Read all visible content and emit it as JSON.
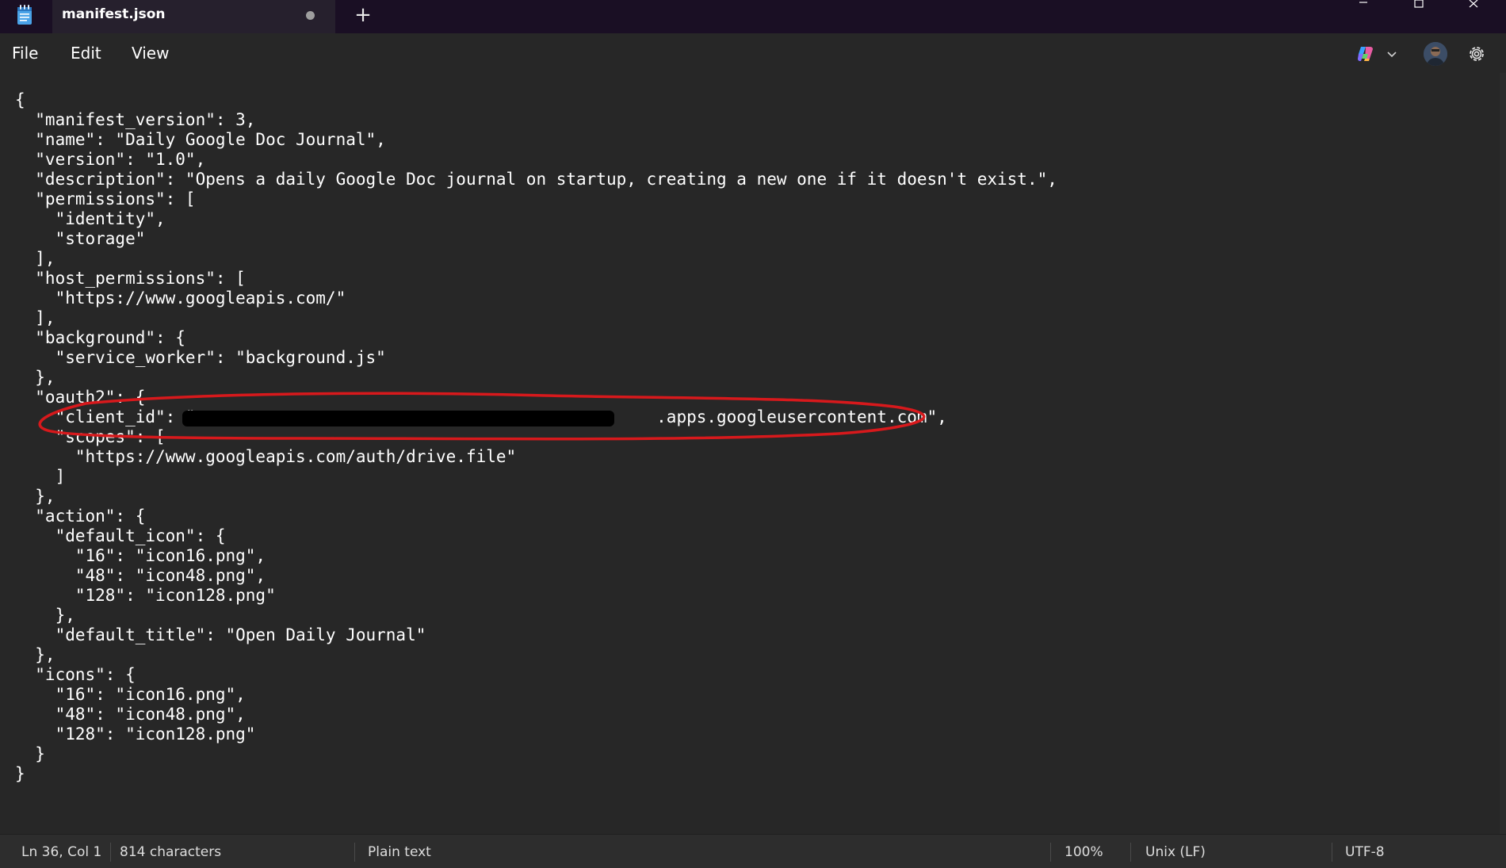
{
  "titlebar": {
    "tab_title": "manifest.json",
    "new_tab_label": "+",
    "app_icon": "notepad-icon",
    "unsaved_indicator": "dot",
    "window_controls": [
      "minimize-icon",
      "maximize-icon",
      "close-icon"
    ]
  },
  "menu": {
    "file": "File",
    "edit": "Edit",
    "view": "View",
    "right_icons": [
      "copilot-icon",
      "chevron-down-icon",
      "avatar",
      "gear-icon"
    ]
  },
  "editor": {
    "lines": [
      "{",
      "  \"manifest_version\": 3,",
      "  \"name\": \"Daily Google Doc Journal\",",
      "  \"version\": \"1.0\",",
      "  \"description\": \"Opens a daily Google Doc journal on startup, creating a new one if it doesn't exist.\",",
      "  \"permissions\": [",
      "    \"identity\",",
      "    \"storage\"",
      "  ],",
      "  \"host_permissions\": [",
      "    \"https://www.googleapis.com/\"",
      "  ],",
      "  \"background\": {",
      "    \"service_worker\": \"background.js\"",
      "  },",
      "  \"oauth2\": {",
      "    \"client_id\": \"                                              .apps.googleusercontent.com\",",
      "    \"scopes\": [",
      "      \"https://www.googleapis.com/auth/drive.file\"",
      "    ]",
      "  },",
      "  \"action\": {",
      "    \"default_icon\": {",
      "      \"16\": \"icon16.png\",",
      "      \"48\": \"icon48.png\",",
      "      \"128\": \"icon128.png\"",
      "    },",
      "    \"default_title\": \"Open Daily Journal\"",
      "  },",
      "  \"icons\": {",
      "    \"16\": \"icon16.png\",",
      "    \"48\": \"icon48.png\",",
      "    \"128\": \"icon128.png\"",
      "  }",
      "}"
    ],
    "redacted_line": 16,
    "annotation_color": "#d7191c"
  },
  "status": {
    "position": "Ln 36, Col 1",
    "characters": "814 characters",
    "format": "Plain text",
    "zoom": "100%",
    "line_ending": "Unix (LF)",
    "encoding": "UTF-8"
  },
  "colors": {
    "titlebar_bg": "#1a0f24",
    "tab_bg": "#26202d",
    "editor_bg": "#272727",
    "statusbar_bg": "#2d2d2d",
    "text": "#ffffff"
  }
}
